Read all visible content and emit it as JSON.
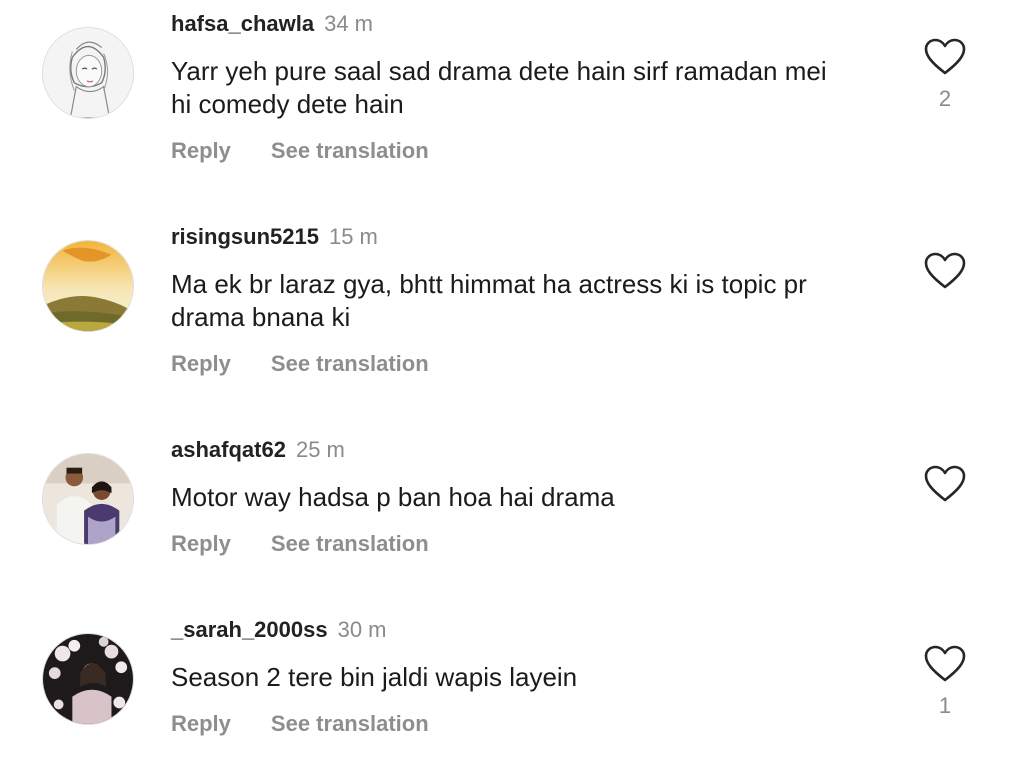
{
  "comments": [
    {
      "username": "hafsa_chawla",
      "time": "34 m",
      "text_lines": [
        "Yarr yeh pure saal sad drama dete hain sirf ramadan mei",
        "hi comedy dete hain"
      ],
      "reply_label": "Reply",
      "translate_label": "See translation",
      "likes": "2",
      "avatar": "sketch-woman-avatar"
    },
    {
      "username": "risingsun5215",
      "time": "15 m",
      "text_lines": [
        "Ma ek br laraz gya, bhtt himmat ha actress ki is topic pr",
        "drama bnana ki"
      ],
      "reply_label": "Reply",
      "translate_label": "See translation",
      "likes": "",
      "avatar": "sunset-landscape-avatar"
    },
    {
      "username": "ashafqat62",
      "time": "25 m",
      "text_lines": [
        "Motor way hadsa p ban hoa hai drama"
      ],
      "reply_label": "Reply",
      "translate_label": "See translation",
      "likes": "",
      "avatar": "couple-photo-avatar"
    },
    {
      "username": "_sarah_2000ss",
      "time": "30 m",
      "text_lines": [
        "Season 2 tere bin jaldi wapis layein"
      ],
      "reply_label": "Reply",
      "translate_label": "See translation",
      "likes": "1",
      "avatar": "flowers-photo-avatar"
    }
  ],
  "colors": {
    "text": "#1b1b1b",
    "muted": "#8e8e8e",
    "heart_outline": "#262626"
  }
}
